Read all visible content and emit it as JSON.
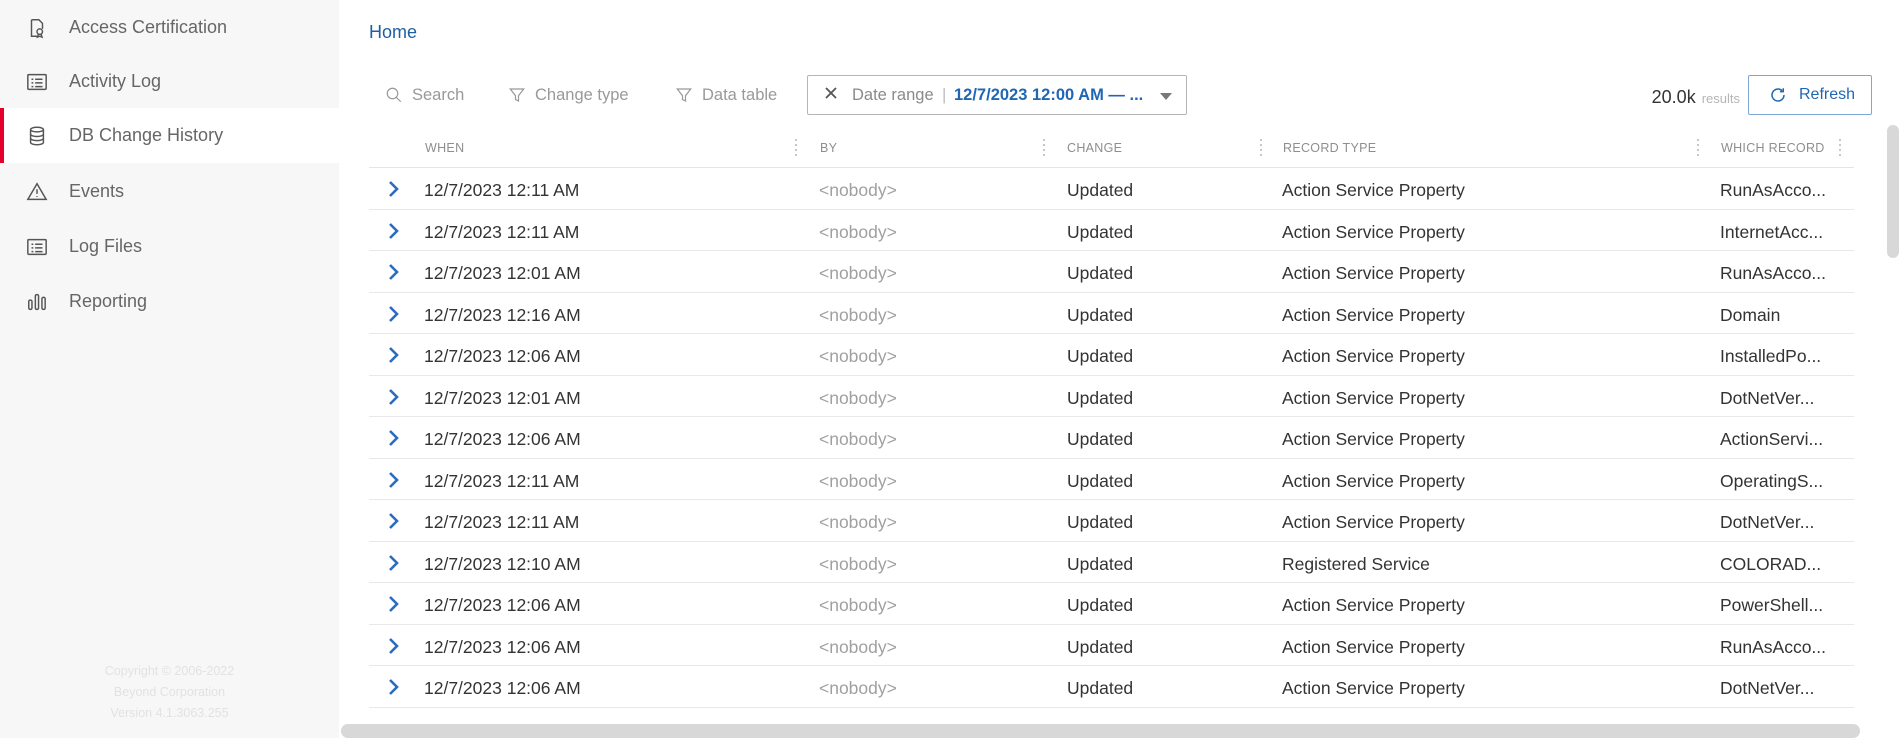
{
  "sidebar": {
    "items": [
      {
        "label": "Access Certification",
        "icon": "certificate-icon"
      },
      {
        "label": "Activity Log",
        "icon": "list-icon"
      },
      {
        "label": "DB Change History",
        "icon": "database-icon",
        "active": true
      },
      {
        "label": "Events",
        "icon": "warning-icon"
      },
      {
        "label": "Log Files",
        "icon": "list-icon"
      },
      {
        "label": "Reporting",
        "icon": "bar-chart-icon"
      }
    ],
    "copyright": [
      "Copyright © 2006-2022",
      "Beyond Corporation",
      "Version 4.1.3063.255"
    ]
  },
  "breadcrumb": {
    "home": "Home"
  },
  "toolbar": {
    "search_label": "Search",
    "change_type_label": "Change type",
    "data_table_label": "Data table",
    "date_range_label": "Date range",
    "date_range_separator": "|",
    "date_range_value": "12/7/2023 12:00 AM — ...",
    "results_count": "20.0k",
    "results_unit": "results",
    "refresh_label": "Refresh"
  },
  "table": {
    "columns": {
      "when": "WHEN",
      "by": "BY",
      "change": "CHANGE",
      "record_type": "RECORD TYPE",
      "which_record": "WHICH RECORD"
    },
    "rows": [
      {
        "when": "12/7/2023 12:11 AM",
        "by": "<nobody>",
        "change": "Updated",
        "record_type": "Action Service Property",
        "which_record": "RunAsAcco..."
      },
      {
        "when": "12/7/2023 12:11 AM",
        "by": "<nobody>",
        "change": "Updated",
        "record_type": "Action Service Property",
        "which_record": "InternetAcc..."
      },
      {
        "when": "12/7/2023 12:01 AM",
        "by": "<nobody>",
        "change": "Updated",
        "record_type": "Action Service Property",
        "which_record": "RunAsAcco..."
      },
      {
        "when": "12/7/2023 12:16 AM",
        "by": "<nobody>",
        "change": "Updated",
        "record_type": "Action Service Property",
        "which_record": "Domain"
      },
      {
        "when": "12/7/2023 12:06 AM",
        "by": "<nobody>",
        "change": "Updated",
        "record_type": "Action Service Property",
        "which_record": "InstalledPo..."
      },
      {
        "when": "12/7/2023 12:01 AM",
        "by": "<nobody>",
        "change": "Updated",
        "record_type": "Action Service Property",
        "which_record": "DotNetVer..."
      },
      {
        "when": "12/7/2023 12:06 AM",
        "by": "<nobody>",
        "change": "Updated",
        "record_type": "Action Service Property",
        "which_record": "ActionServi..."
      },
      {
        "when": "12/7/2023 12:11 AM",
        "by": "<nobody>",
        "change": "Updated",
        "record_type": "Action Service Property",
        "which_record": "OperatingS..."
      },
      {
        "when": "12/7/2023 12:11 AM",
        "by": "<nobody>",
        "change": "Updated",
        "record_type": "Action Service Property",
        "which_record": "DotNetVer..."
      },
      {
        "when": "12/7/2023 12:10 AM",
        "by": "<nobody>",
        "change": "Updated",
        "record_type": "Registered Service",
        "which_record": "COLORAD..."
      },
      {
        "when": "12/7/2023 12:06 AM",
        "by": "<nobody>",
        "change": "Updated",
        "record_type": "Action Service Property",
        "which_record": "PowerShell..."
      },
      {
        "when": "12/7/2023 12:06 AM",
        "by": "<nobody>",
        "change": "Updated",
        "record_type": "Action Service Property",
        "which_record": "RunAsAcco..."
      },
      {
        "when": "12/7/2023 12:06 AM",
        "by": "<nobody>",
        "change": "Updated",
        "record_type": "Action Service Property",
        "which_record": "DotNetVer..."
      }
    ]
  },
  "colors": {
    "accent": "#1f67b5",
    "active_marker": "#e4002b",
    "sidebar_bg": "#f7f7f7"
  }
}
